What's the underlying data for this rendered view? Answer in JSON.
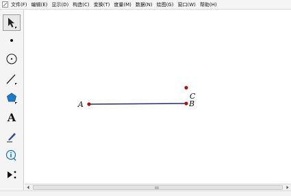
{
  "menu": {
    "items": [
      {
        "label": "文件(F)"
      },
      {
        "label": "编辑(E)"
      },
      {
        "label": "显示(D)"
      },
      {
        "label": "构造(C)"
      },
      {
        "label": "变换(T)"
      },
      {
        "label": "度量(M)"
      },
      {
        "label": "数据(N)"
      },
      {
        "label": "绘图(G)"
      },
      {
        "label": "窗口(W)"
      },
      {
        "label": "帮助(H)"
      }
    ]
  },
  "toolbar": {
    "tools": [
      {
        "icon": "arrow-select-icon",
        "selected": true
      },
      {
        "icon": "point-tool-icon"
      },
      {
        "icon": "compass-tool-icon"
      },
      {
        "icon": "straightedge-tool-icon"
      },
      {
        "icon": "polygon-tool-icon"
      },
      {
        "icon": "text-tool-icon",
        "glyph": "A"
      },
      {
        "icon": "marker-tool-icon"
      },
      {
        "icon": "information-tool-icon"
      },
      {
        "icon": "custom-tools-icon"
      }
    ]
  },
  "canvas": {
    "labels": {
      "a": "A",
      "b": "B",
      "c": "C"
    },
    "colors": {
      "segment": "#1c2f73",
      "point": "#a31515"
    }
  }
}
